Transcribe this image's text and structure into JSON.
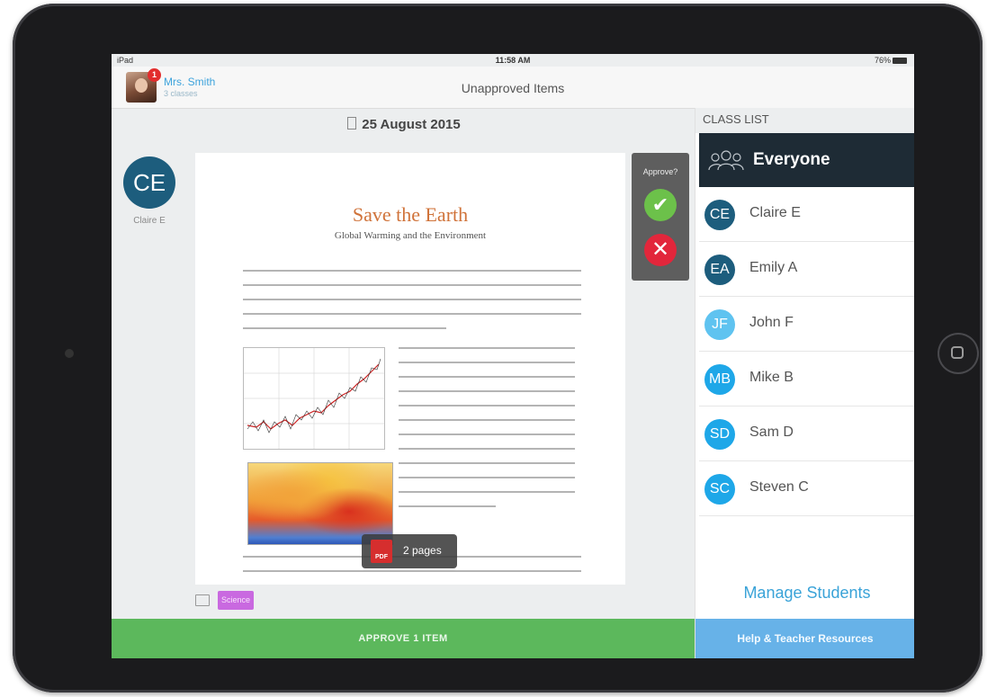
{
  "status_bar": {
    "device": "iPad",
    "time": "11:58 AM",
    "battery": "76%"
  },
  "nav": {
    "teacher_name": "Mrs. Smith",
    "teacher_sub": "3 classes",
    "notification_count": "1",
    "title": "Unapproved Items"
  },
  "item": {
    "date": "25 August 2015",
    "student_initials": "CE",
    "student_name": "Claire E",
    "doc_title": "Save the Earth",
    "doc_subtitle": "Global Warming and the Environment",
    "pages_label": "2 pages",
    "pdf_icon_text": "PDF",
    "tag": "Science"
  },
  "approve": {
    "label": "Approve?",
    "yes_icon": "check-icon",
    "no_icon": "close-icon",
    "bar_label": "APPROVE 1 ITEM"
  },
  "sidebar": {
    "title": "CLASS LIST",
    "everyone_label": "Everyone",
    "students": [
      {
        "initials": "CE",
        "name": "Claire E",
        "color": "#1d5d7d"
      },
      {
        "initials": "EA",
        "name": "Emily A",
        "color": "#1d5d7d"
      },
      {
        "initials": "JF",
        "name": "John F",
        "color": "#5fc3f0"
      },
      {
        "initials": "MB",
        "name": "Mike B",
        "color": "#1ea7e8"
      },
      {
        "initials": "SD",
        "name": "Sam D",
        "color": "#1ea7e8"
      },
      {
        "initials": "SC",
        "name": "Steven C",
        "color": "#1ea7e8"
      }
    ],
    "manage_label": "Manage Students",
    "help_label": "Help & Teacher Resources"
  }
}
